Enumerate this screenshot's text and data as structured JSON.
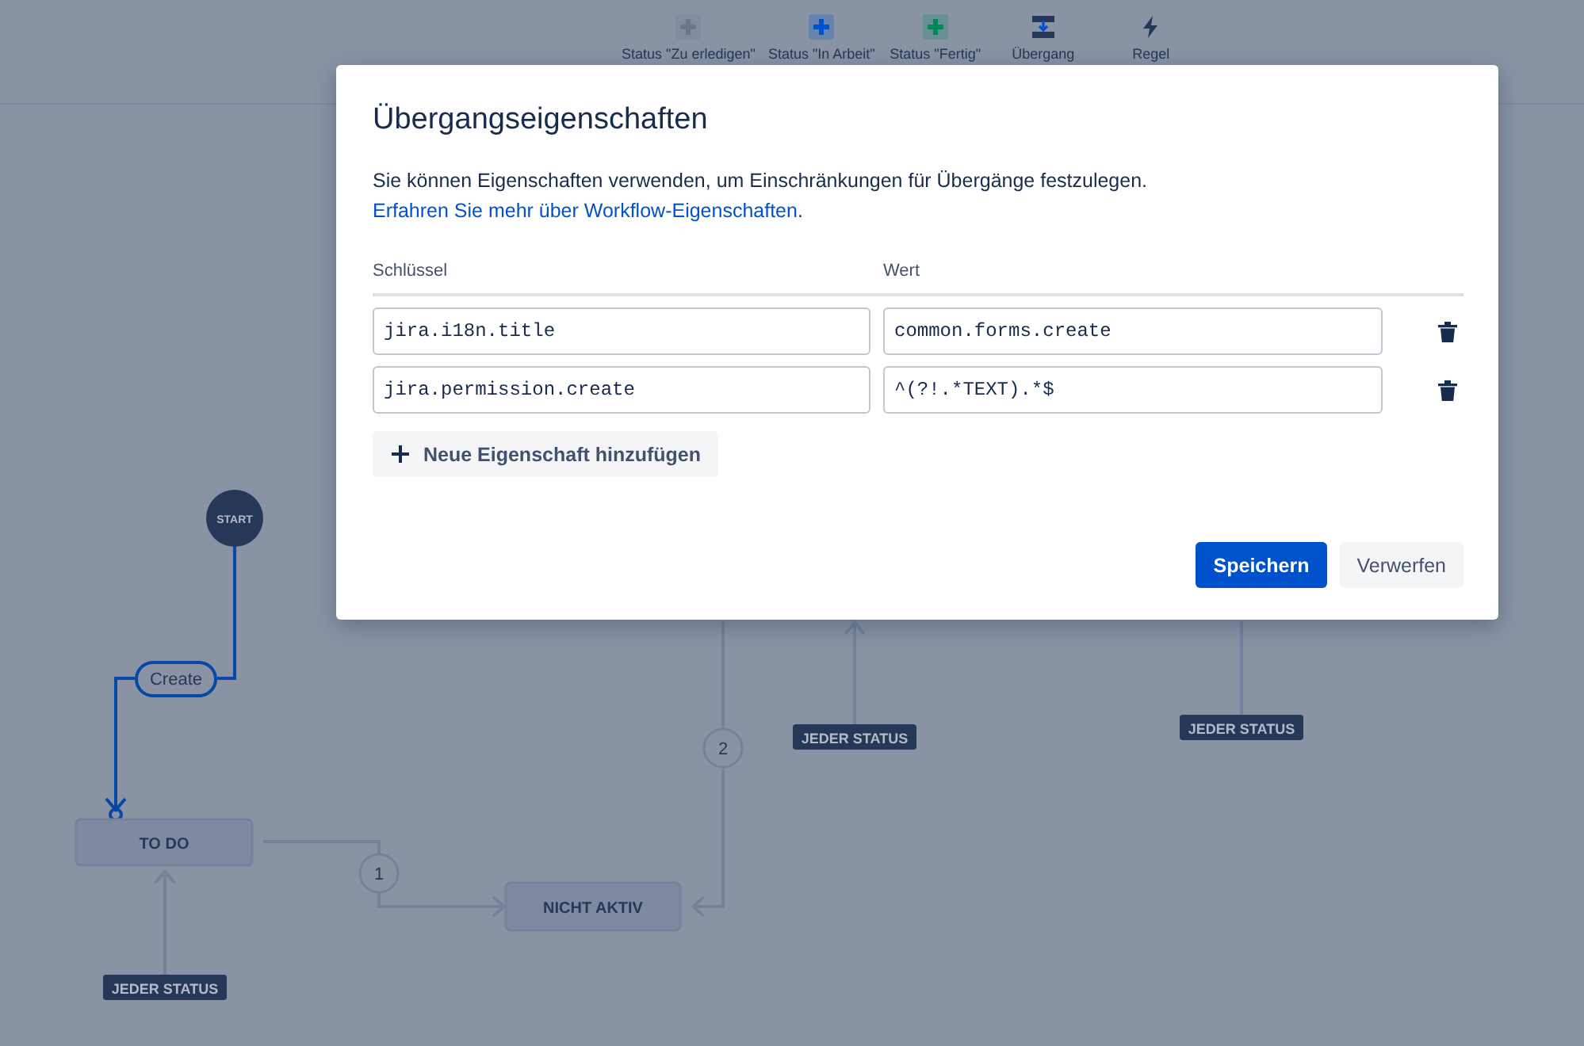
{
  "toolbar": [
    {
      "label": "Status \"Zu erledigen\"",
      "kind": "status",
      "color": "#6b778c"
    },
    {
      "label": "Status \"In Arbeit\"",
      "kind": "status",
      "color": "#0052cc"
    },
    {
      "label": "Status \"Fertig\"",
      "kind": "status",
      "color": "#00875a"
    },
    {
      "label": "Übergang",
      "kind": "transition"
    },
    {
      "label": "Regel",
      "kind": "rule"
    }
  ],
  "diagram": {
    "start": "START",
    "transition_label": "Create",
    "statuses": [
      "TO DO",
      "NICHT AKTIV"
    ],
    "transition_numbers": [
      "1",
      "2"
    ],
    "any_status_badges": [
      "JEDER STATUS",
      "JEDER STATUS",
      "JEDER STATUS"
    ]
  },
  "dialog": {
    "title": "Übergangseigenschaften",
    "description": "Sie können Eigenschaften verwenden, um Einschränkungen für Übergänge festzulegen.",
    "link": "Erfahren Sie mehr über Workflow-Eigenschaften",
    "link_suffix": ".",
    "columns": [
      "Schlüssel",
      "Wert"
    ],
    "rows": [
      {
        "key": "jira.i18n.title",
        "value": "common.forms.create"
      },
      {
        "key": "jira.permission.create",
        "value": "^(?!.*TEXT).*$"
      }
    ],
    "add_button": "Neue Eigenschaft hinzufügen",
    "buttons": [
      {
        "label": "Speichern",
        "kind": "primary"
      },
      {
        "label": "Verwerfen",
        "kind": "secondary"
      }
    ]
  }
}
